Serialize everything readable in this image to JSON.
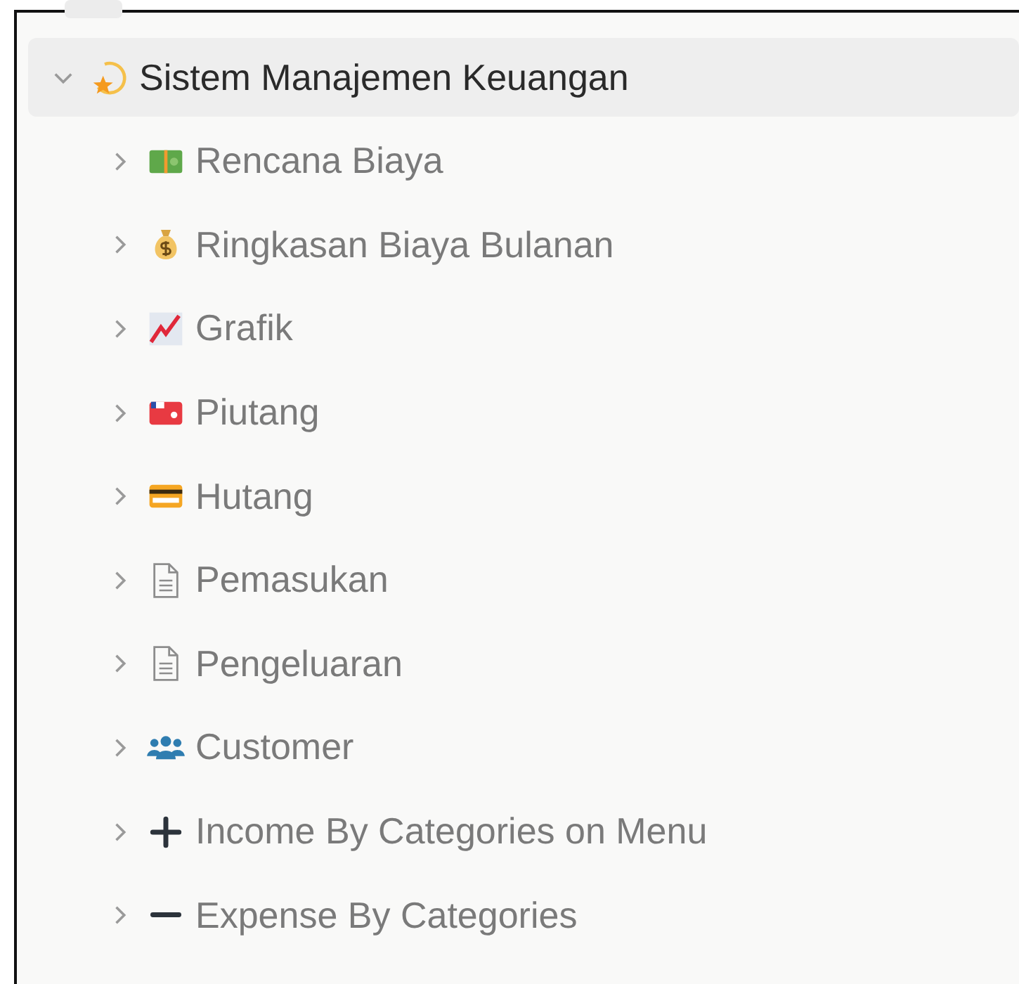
{
  "tree": {
    "label": "Sistem Manajemen Keuangan",
    "kind": "star",
    "expanded": true,
    "selected": true,
    "children": [
      {
        "label": "Rencana Biaya",
        "kind": "banknote",
        "expanded": false,
        "selected": false
      },
      {
        "label": "Ringkasan Biaya Bulanan",
        "kind": "moneybag",
        "expanded": false,
        "selected": false
      },
      {
        "label": "Grafik",
        "kind": "chart",
        "expanded": false,
        "selected": false
      },
      {
        "label": "Piutang",
        "kind": "wallet",
        "expanded": false,
        "selected": false
      },
      {
        "label": "Hutang",
        "kind": "card",
        "expanded": false,
        "selected": false
      },
      {
        "label": "Pemasukan",
        "kind": "document",
        "expanded": false,
        "selected": false
      },
      {
        "label": "Pengeluaran",
        "kind": "document",
        "expanded": false,
        "selected": false
      },
      {
        "label": "Customer",
        "kind": "people",
        "expanded": false,
        "selected": false
      },
      {
        "label": "Income By Categories on Menu",
        "kind": "plus",
        "expanded": false,
        "selected": false
      },
      {
        "label": "Expense By Categories",
        "kind": "minus",
        "expanded": false,
        "selected": false
      }
    ]
  }
}
